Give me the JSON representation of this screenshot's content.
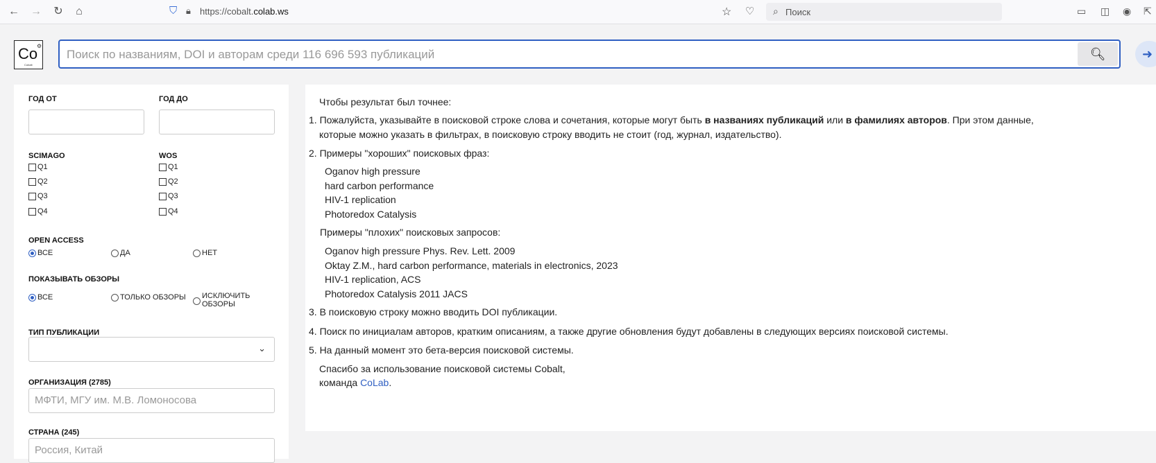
{
  "browser": {
    "url_prefix": "https://cobalt.",
    "url_domain": "colab.ws",
    "search_placeholder": "Поиск"
  },
  "header": {
    "logo_text": "Co",
    "logo_sub": "Cobalt",
    "search_placeholder": "Поиск по названиям, DOI и авторам среди 116 696 593 публикаций"
  },
  "filters": {
    "year_from_label": "ГОД ОТ",
    "year_to_label": "ГОД ДО",
    "scimago_label": "SCIMAGO",
    "wos_label": "WOS",
    "quartiles": [
      "Q1",
      "Q2",
      "Q3",
      "Q4"
    ],
    "open_access_label": "OPEN ACCESS",
    "open_access_options": [
      "ВСЕ",
      "ДА",
      "НЕТ"
    ],
    "reviews_label": "ПОКАЗЫВАТЬ ОБЗОРЫ",
    "reviews_options": [
      "ВСЕ",
      "ТОЛЬКО ОБЗОРЫ",
      "ИСКЛЮЧИТЬ",
      "ОБЗОРЫ"
    ],
    "pub_type_label": "ТИП ПУБЛИКАЦИИ",
    "org_label": "ОРГАНИЗАЦИЯ (2785)",
    "org_placeholder": "МФТИ, МГУ им. М.В. Ломоносова",
    "country_label": "СТРАНА (245)",
    "country_placeholder": "Россия, Китай"
  },
  "help": {
    "intro": "Чтобы результат был точнее:",
    "p1_a": "1. Пожалуйста, указывайте в поисковой строке слова и сочетания, которые могут быть ",
    "p1_b": "в названиях публикаций",
    "p1_c": " или ",
    "p1_d": "в фамилиях авторов",
    "p1_e": ". При этом данные,",
    "p1_line2": "которые можно указать в фильтрах, в поисковую строку вводить не стоит (год, журнал, издательство).",
    "p2": "2. Примеры \"хороших\" поисковых фраз:",
    "good_examples": [
      "Oganov high pressure",
      "hard carbon performance",
      "HIV-1 replication",
      "Photoredox Catalysis"
    ],
    "bad_intro": "Примеры \"плохих\" поисковых запросов:",
    "bad_examples": [
      "Oganov high pressure Phys. Rev. Lett. 2009",
      "Oktay Z.M., hard carbon performance, materials in electronics, 2023",
      "HIV-1 replication, ACS",
      "Photoredox Catalysis 2011 JACS"
    ],
    "p3": "3. В поисковую строку можно вводить DOI публикации.",
    "p4": "4. Поиск по инициалам авторов, кратким описаниям, а также другие обновления будут добавлены в следующих версиях поисковой системы.",
    "p5": "5. На данный момент это бета-версия поисковой системы.",
    "thanks": "Спасибо за использование поисковой системы Cobalt,",
    "team_prefix": "команда ",
    "team_link": "CoLab",
    "team_suffix": "."
  }
}
